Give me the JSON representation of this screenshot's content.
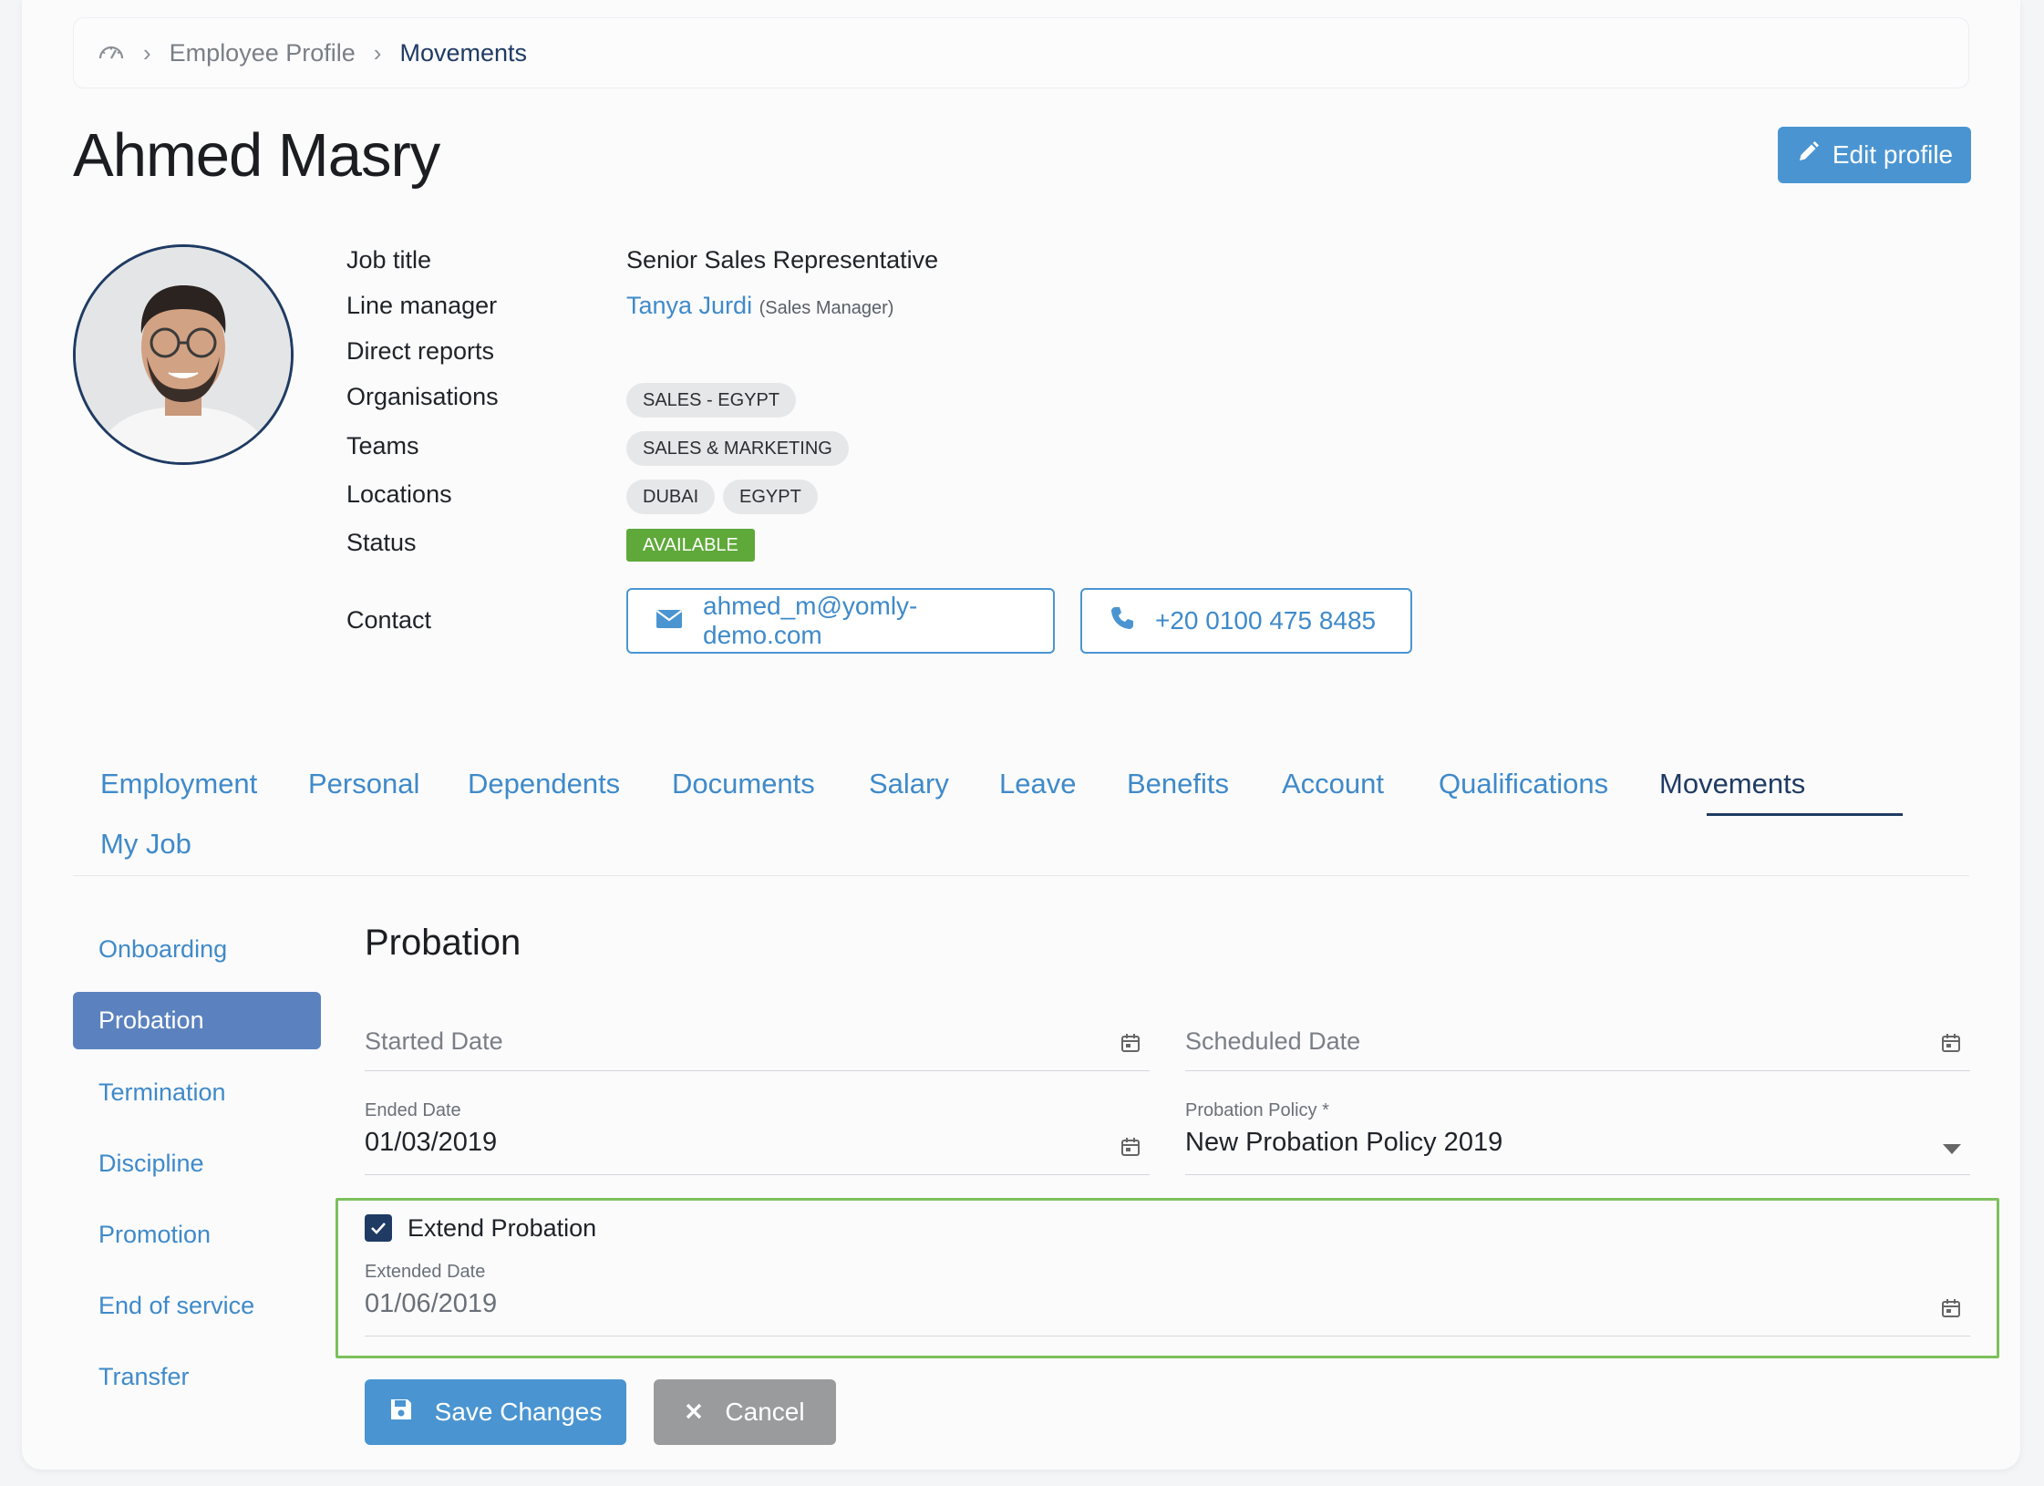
{
  "breadcrumb": {
    "home_icon": "dashboard-gauge-icon",
    "items": [
      {
        "label": "Employee Profile"
      },
      {
        "label": "Movements"
      }
    ]
  },
  "header": {
    "employee_name": "Ahmed Masry",
    "edit_label": "Edit profile"
  },
  "profile": {
    "labels": {
      "job_title": "Job title",
      "line_manager": "Line manager",
      "direct_reports": "Direct reports",
      "organisations": "Organisations",
      "teams": "Teams",
      "locations": "Locations",
      "status": "Status",
      "contact": "Contact"
    },
    "job_title": "Senior Sales Representative",
    "line_manager": {
      "name": "Tanya Jurdi",
      "role": "(Sales Manager)"
    },
    "organisations": [
      "SALES - EGYPT"
    ],
    "teams": [
      "SALES & MARKETING"
    ],
    "locations": [
      "DUBAI",
      "EGYPT"
    ],
    "status": "AVAILABLE",
    "email": "ahmed_m@yomly-demo.com",
    "phone": "+20 0100 475 8485"
  },
  "tabs": [
    {
      "label": "Employment"
    },
    {
      "label": "Personal"
    },
    {
      "label": "Dependents"
    },
    {
      "label": "Documents"
    },
    {
      "label": "Salary"
    },
    {
      "label": "Leave"
    },
    {
      "label": "Benefits"
    },
    {
      "label": "Account"
    },
    {
      "label": "Qualifications"
    },
    {
      "label": "Movements",
      "active": true
    },
    {
      "label": "My Job"
    }
  ],
  "sidebar": {
    "items": [
      {
        "label": "Onboarding"
      },
      {
        "label": "Probation",
        "active": true
      },
      {
        "label": "Termination"
      },
      {
        "label": "Discipline"
      },
      {
        "label": "Promotion"
      },
      {
        "label": "End of service"
      },
      {
        "label": "Transfer"
      }
    ]
  },
  "probation": {
    "title": "Probation",
    "started_date": {
      "placeholder": "Started Date"
    },
    "scheduled_date": {
      "placeholder": "Scheduled Date"
    },
    "ended_date": {
      "label": "Ended Date",
      "value": "01/03/2019"
    },
    "policy": {
      "label": "Probation Policy *",
      "value": "New Probation Policy 2019"
    },
    "extend": {
      "label": "Extend Probation",
      "checked": true
    },
    "extended_date": {
      "label": "Extended Date",
      "value": "01/06/2019"
    }
  },
  "actions": {
    "save_label": "Save Changes",
    "cancel_label": "Cancel"
  },
  "colors": {
    "accent": "#4a95d1",
    "navy": "#1f3b63",
    "status_green": "#5fa93a",
    "highlight_green": "#7cc15c"
  }
}
